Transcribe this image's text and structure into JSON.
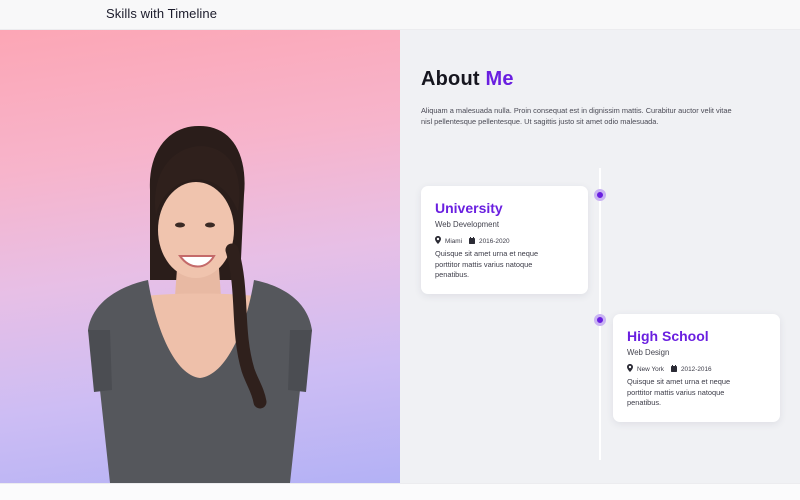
{
  "header": {
    "title": "Skills with Timeline"
  },
  "about": {
    "title_main": "About",
    "title_accent": "Me",
    "text": "Aliquam a malesuada nulla. Proin consequat est in dignissim mattis. Curabitur auctor velit vitae nisl pellentesque pellentesque. Ut sagittis justo sit amet odio malesuada."
  },
  "timeline": [
    {
      "title": "University",
      "subtitle": "Web Development",
      "location": "Miami",
      "years": "2016-2020",
      "description": "Quisque sit amet urna et neque porttitor mattis varius natoque penatibus."
    },
    {
      "title": "High School",
      "subtitle": "Web Design",
      "location": "New York",
      "years": "2012-2016",
      "description": "Quisque sit amet urna et neque porttitor mattis varius natoque penatibus."
    }
  ],
  "colors": {
    "accent": "#6a1fe0",
    "hero_gradient": [
      "#fca6b5",
      "#cdbdf4",
      "#b3b1f5"
    ]
  },
  "icons": {
    "location": "map-marker-icon",
    "calendar": "calendar-icon"
  }
}
